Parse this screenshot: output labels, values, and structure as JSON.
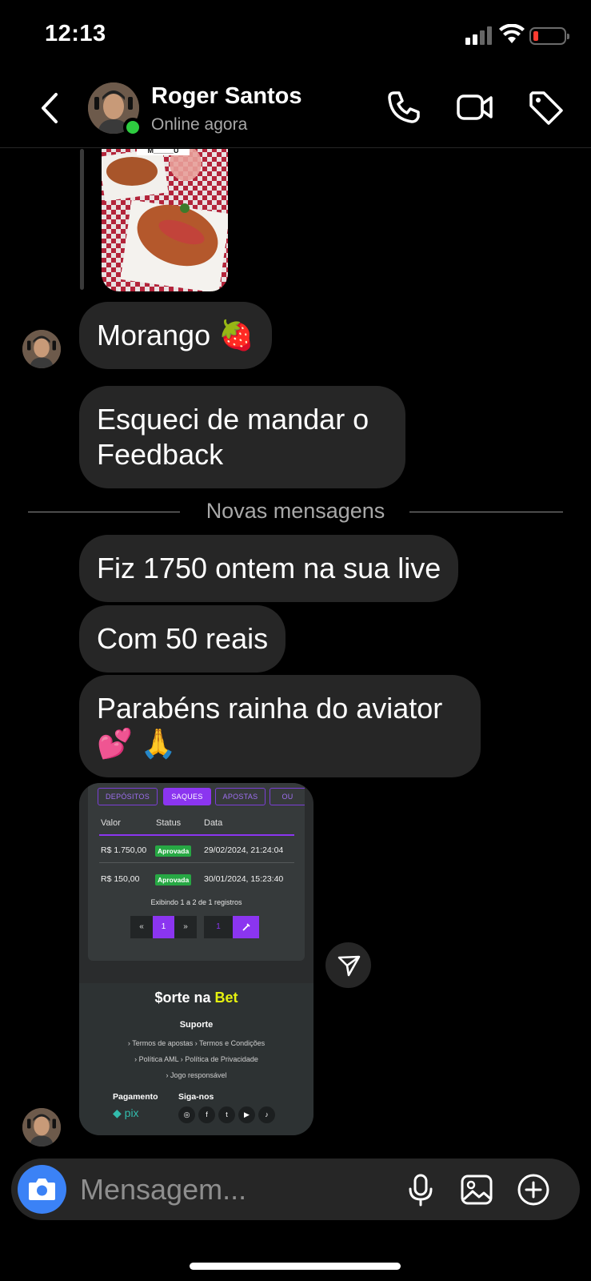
{
  "status_bar": {
    "time": "12:13"
  },
  "header": {
    "contact_name": "Roger Santos",
    "contact_status": "Online agora",
    "icons": [
      "back-icon",
      "phone-icon",
      "video-icon",
      "tag-icon"
    ]
  },
  "messages": [
    {
      "text": "Morango 🍓"
    },
    {
      "text": "Esqueci de mandar o Feedback"
    },
    {
      "text": "Fiz 1750 ontem na sua live"
    },
    {
      "text": "Com 50 reais"
    },
    {
      "text": "Parabéns rainha do aviator 💕 🙏"
    }
  ],
  "divider": {
    "label": "Novas mensagens"
  },
  "story_caption": "M_____U",
  "screenshot": {
    "tabs": [
      "DEPÓSITOS",
      "SAQUES",
      "APOSTAS",
      "OU"
    ],
    "active_tab": "SAQUES",
    "columns": [
      "Valor",
      "Status",
      "Data"
    ],
    "rows": [
      {
        "valor": "R$ 1.750,00",
        "status": "Aprovada",
        "data": "29/02/2024, 21:24:04"
      },
      {
        "valor": "R$ 150,00",
        "status": "Aprovada",
        "data": "30/01/2024, 15:23:40"
      }
    ],
    "info": "Exibindo 1 a 2 de 1 registros",
    "pagination": [
      "«",
      "1",
      "»"
    ],
    "page_input": "1",
    "brand_prefix": "$orte na ",
    "brand_suffix": "Bet",
    "support_title": "Suporte",
    "links_row1": "› Termos de apostas   › Termos e Condições",
    "links_row2": "› Política AML   › Política de Privacidade",
    "links_row3": "› Jogo responsável",
    "payment_label": "Pagamento",
    "follow_label": "Siga-nos",
    "pix_label": "pix",
    "social_icons": [
      "instagram-icon",
      "facebook-icon",
      "twitter-icon",
      "youtube-icon",
      "tiktok-icon"
    ],
    "social_glyphs": [
      "◎",
      "f",
      "t",
      "▶",
      "♪"
    ],
    "colors": {
      "accent": "#8b35f0",
      "approved": "#27a844",
      "brand_yellow": "#e6f20f",
      "pix": "#32bcad"
    }
  },
  "composer": {
    "placeholder": "Mensagem...",
    "icons": [
      "camera-icon",
      "microphone-icon",
      "gallery-icon",
      "add-icon"
    ]
  },
  "colors": {
    "bubble": "#262626",
    "background": "#000000",
    "online": "#2ecc40",
    "camera_button": "#3b82f6"
  }
}
